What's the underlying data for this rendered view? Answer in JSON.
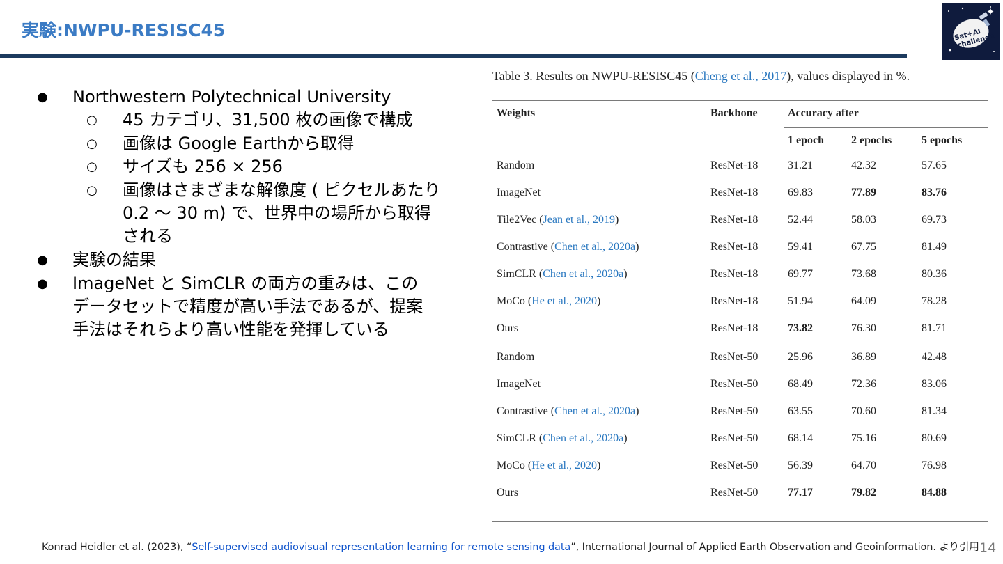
{
  "slide": {
    "title": "実験:NWPU-RESISC45",
    "page_number": "14",
    "logo_text": [
      "Sat+AI",
      "challenge"
    ]
  },
  "bullets": [
    {
      "level": 1,
      "text": "Northwestern Polytechnical University"
    },
    {
      "level": 2,
      "text": "45 カテゴリ、31,500 枚の画像で構成"
    },
    {
      "level": 2,
      "text": "画像は Google Earthから取得"
    },
    {
      "level": 2,
      "text": "サイズも 256 × 256"
    },
    {
      "level": 2,
      "lines": [
        "画像はさまざまな解像度 ( ピクセルあたり",
        "0.2 〜 30 m) で、世界中の場所から取得",
        "される"
      ]
    },
    {
      "level": 1,
      "text": "実験の結果"
    },
    {
      "level": 1,
      "lines": [
        "ImageNet と SimCLR の両方の重みは、この",
        "データセットで精度が高い手法であるが、提案",
        "手法はそれらより高い性能を発揮している"
      ]
    }
  ],
  "table": {
    "caption_prefix": "Table 3. Results on NWPU-RESISC45 (",
    "caption_link": "Cheng et al., 2017",
    "caption_suffix": "), values displayed in %.",
    "headers": {
      "weights": "Weights",
      "backbone": "Backbone",
      "accuracy_after": "Accuracy after",
      "epoch1": "1 epoch",
      "epoch2": "2 epochs",
      "epoch5": "5 epochs"
    },
    "rows": [
      {
        "name": "Random",
        "cite": "",
        "backbone": "ResNet-18",
        "e1": "31.21",
        "e2": "42.32",
        "e5": "57.65",
        "bold": []
      },
      {
        "name": "ImageNet",
        "cite": "",
        "backbone": "ResNet-18",
        "e1": "69.83",
        "e2": "77.89",
        "e5": "83.76",
        "bold": [
          "e2",
          "e5"
        ]
      },
      {
        "name": "Tile2Vec",
        "cite": "Jean et al., 2019",
        "backbone": "ResNet-18",
        "e1": "52.44",
        "e2": "58.03",
        "e5": "69.73",
        "bold": []
      },
      {
        "name": "Contrastive",
        "cite": "Chen et al., 2020a",
        "backbone": "ResNet-18",
        "e1": "59.41",
        "e2": "67.75",
        "e5": "81.49",
        "bold": []
      },
      {
        "name": "SimCLR",
        "cite": "Chen et al., 2020a",
        "backbone": "ResNet-18",
        "e1": "69.77",
        "e2": "73.68",
        "e5": "80.36",
        "bold": []
      },
      {
        "name": "MoCo",
        "cite": "He et al., 2020",
        "backbone": "ResNet-18",
        "e1": "51.94",
        "e2": "64.09",
        "e5": "78.28",
        "bold": []
      },
      {
        "name": "Ours",
        "cite": "",
        "backbone": "ResNet-18",
        "e1": "73.82",
        "e2": "76.30",
        "e5": "81.71",
        "bold": [
          "e1"
        ]
      },
      {
        "name": "Random",
        "cite": "",
        "backbone": "ResNet-50",
        "e1": "25.96",
        "e2": "36.89",
        "e5": "42.48",
        "bold": []
      },
      {
        "name": "ImageNet",
        "cite": "",
        "backbone": "ResNet-50",
        "e1": "68.49",
        "e2": "72.36",
        "e5": "83.06",
        "bold": []
      },
      {
        "name": "Contrastive",
        "cite": "Chen et al., 2020a",
        "backbone": "ResNet-50",
        "e1": "63.55",
        "e2": "70.60",
        "e5": "81.34",
        "bold": []
      },
      {
        "name": "SimCLR",
        "cite": "Chen et al., 2020a",
        "backbone": "ResNet-50",
        "e1": "68.14",
        "e2": "75.16",
        "e5": "80.69",
        "bold": []
      },
      {
        "name": "MoCo",
        "cite": "He et al., 2020",
        "backbone": "ResNet-50",
        "e1": "56.39",
        "e2": "64.70",
        "e5": "76.98",
        "bold": []
      },
      {
        "name": "Ours",
        "cite": "",
        "backbone": "ResNet-50",
        "e1": "77.17",
        "e2": "79.82",
        "e5": "84.88",
        "bold": [
          "e1",
          "e2",
          "e5"
        ]
      }
    ]
  },
  "footer": {
    "prefix": "Konrad Heidler et al. (2023), “",
    "link_text": "Self-supervised audiovisual representation learning for remote sensing data",
    "suffix": "”, International Journal of Applied Earth Observation and Geoinformation. より引用"
  },
  "colors": {
    "title": "#3b7bc4",
    "rule": "#1c3a5e",
    "citation_link": "#2a78c0",
    "footer_link": "#1155cc"
  }
}
